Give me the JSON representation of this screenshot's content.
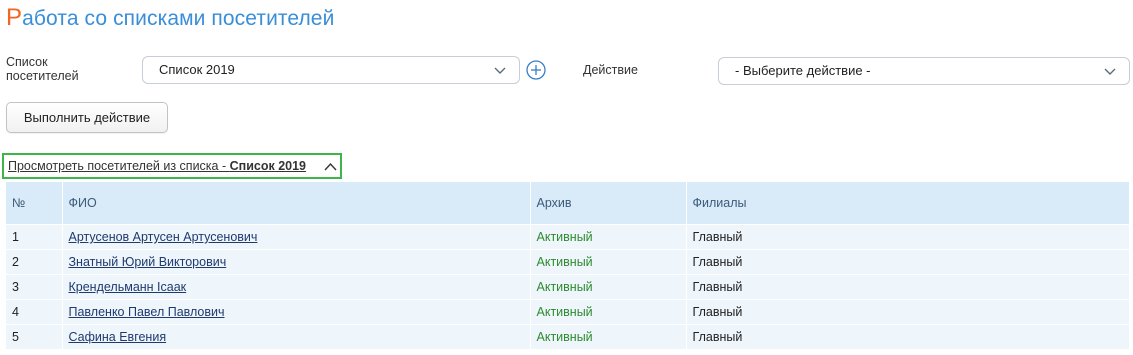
{
  "page": {
    "title_first": "Р",
    "title_rest": "абота со списками посетителей"
  },
  "form": {
    "list_label": "Список посетителей",
    "list_value": "Список 2019",
    "action_label": "Действие",
    "action_value": "- Выберите действие -",
    "execute_label": "Выполнить действие"
  },
  "toggle": {
    "text": "Просмотреть посетителей из списка - ",
    "list_name": "Список 2019"
  },
  "table": {
    "headers": [
      "№",
      "ФИО",
      "Архив",
      "Филиалы"
    ],
    "rows": [
      {
        "num": "1",
        "name": "Артусенов Артусен Артусенович",
        "archive": "Активный",
        "branch": "Главный"
      },
      {
        "num": "2",
        "name": "Знатный Юрий Викторович",
        "archive": "Активный",
        "branch": "Главный"
      },
      {
        "num": "3",
        "name": "Крендельманн Ісаак",
        "archive": "Активный",
        "branch": "Главный"
      },
      {
        "num": "4",
        "name": "Павленко Павел Павлович",
        "archive": "Активный",
        "branch": "Главный"
      },
      {
        "num": "5",
        "name": "Сафина Евгения",
        "archive": "Активный",
        "branch": "Главный"
      }
    ]
  },
  "colors": {
    "title_accent": "#f26522",
    "title": "#3a8ed8",
    "highlight_border": "#3cb54a",
    "table_header_bg": "#d9ebf8",
    "row_bg": "#eef6fc",
    "status_active": "#2e8b2e"
  }
}
